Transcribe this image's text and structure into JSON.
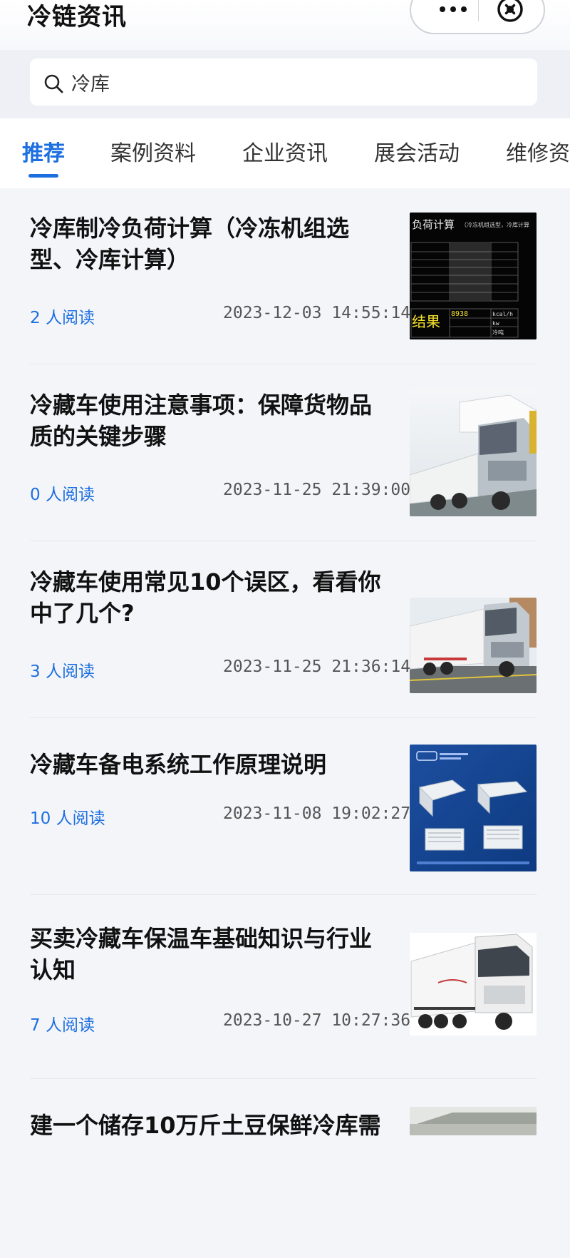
{
  "header": {
    "title": "冷链资讯"
  },
  "search": {
    "query": "冷库"
  },
  "tabs": [
    {
      "label": "推荐",
      "active": true
    },
    {
      "label": "案例资料",
      "active": false
    },
    {
      "label": "企业资讯",
      "active": false
    },
    {
      "label": "展会活动",
      "active": false
    },
    {
      "label": "维修资",
      "active": false
    }
  ],
  "articles": [
    {
      "title": "冷库制冷负荷计算（冷冻机组选型、冷库计算）",
      "reads": "2 人阅读",
      "date": "2023-12-03 14:55:14",
      "thumb": {
        "kind": "calc-table",
        "heading": "负荷计算",
        "subheading": "（冷冻机组选型，冷库计算",
        "result_label": "结果",
        "result_value": "8938",
        "unit": "kcal/h",
        "unit2": "kw",
        "unit3": "冷吨"
      }
    },
    {
      "title": "冷藏车使用注意事项：保障货物品质的关键步骤",
      "reads": "0 人阅读",
      "date": "2023-11-25 21:39:00",
      "thumb": {
        "kind": "truck-photo"
      }
    },
    {
      "title": "冷藏车使用常见10个误区，看看你中了几个?",
      "reads": "3 人阅读",
      "date": "2023-11-25 21:36:14",
      "thumb": {
        "kind": "truck-photo"
      }
    },
    {
      "title": "冷藏车备电系统工作原理说明",
      "reads": "10 人阅读",
      "date": "2023-11-08 19:02:27",
      "thumb": {
        "kind": "units-photo"
      }
    },
    {
      "title": "买卖冷藏车保温车基础知识与行业认知",
      "reads": "7 人阅读",
      "date": "2023-10-27 10:27:36",
      "thumb": {
        "kind": "truck-photo"
      }
    },
    {
      "title": "建一个储存10万斤土豆保鲜冷库需",
      "reads": "",
      "date": "",
      "thumb": {
        "kind": "photo"
      }
    }
  ],
  "colors": {
    "accent": "#1d6fe0",
    "background": "#f3f5f9"
  },
  "icons": [
    "more-icon",
    "close-icon",
    "search-icon"
  ]
}
